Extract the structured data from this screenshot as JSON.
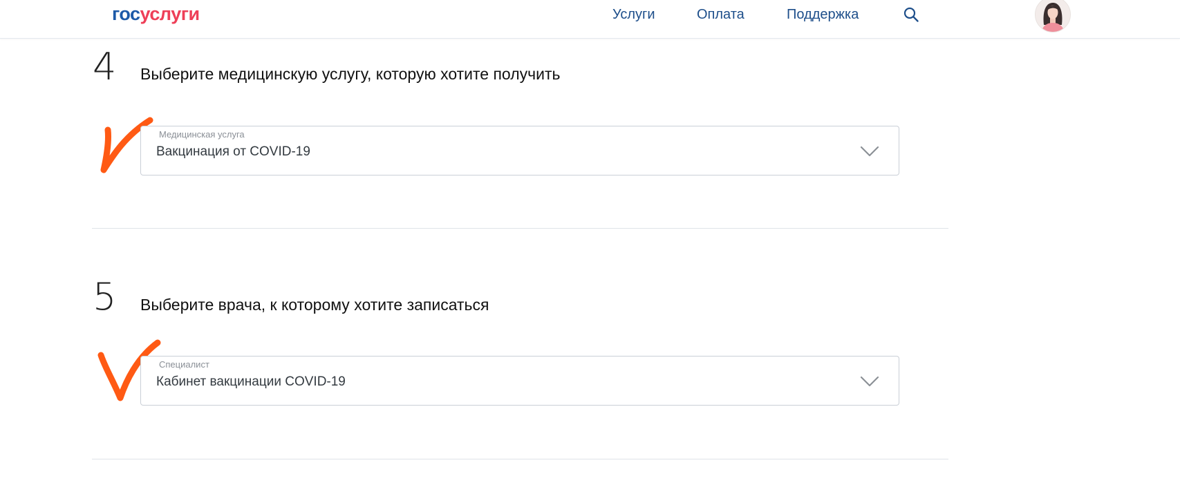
{
  "header": {
    "logo": {
      "part1": "гос",
      "part2": "услуги"
    },
    "nav": [
      {
        "label": "Услуги"
      },
      {
        "label": "Оплата"
      },
      {
        "label": "Поддержка"
      }
    ],
    "icons": {
      "search": "search-icon",
      "avatar": "user-avatar"
    }
  },
  "steps": [
    {
      "number": "4",
      "title": "Выберите медицинскую услугу, которую хотите получить",
      "select": {
        "label": "Медицинская услуга",
        "value": "Вакцинация от COVID-19"
      }
    },
    {
      "number": "5",
      "title": "Выберите врача, к которому хотите записаться",
      "select": {
        "label": "Специалист",
        "value": "Кабинет вакцинации COVID-19"
      }
    }
  ],
  "colors": {
    "logo_blue": "#1d5aa8",
    "logo_red": "#ee3f58",
    "nav_link": "#1d4e8a",
    "annotation_check": "#ff5a14"
  }
}
